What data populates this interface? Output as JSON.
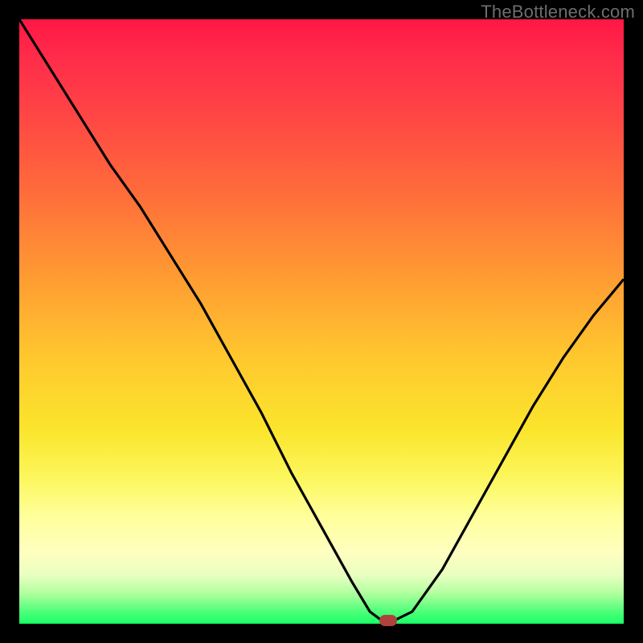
{
  "watermark": "TheBottleneck.com",
  "colors": {
    "curve_stroke": "#000000",
    "marker_fill": "#b0423e",
    "background": "#000000"
  },
  "chart_data": {
    "type": "line",
    "title": "",
    "xlabel": "",
    "ylabel": "",
    "xlim": [
      0,
      100
    ],
    "ylim": [
      0,
      100
    ],
    "grid": false,
    "legend": null,
    "series": [
      {
        "name": "bottleneck-curve",
        "x": [
          0,
          5,
          10,
          15,
          20,
          25,
          30,
          35,
          40,
          45,
          50,
          55,
          58,
          60,
          62,
          65,
          70,
          75,
          80,
          85,
          90,
          95,
          100
        ],
        "y": [
          100,
          92,
          84,
          76,
          69,
          61,
          53,
          44,
          35,
          25,
          16,
          7,
          2,
          0.5,
          0.5,
          2,
          9,
          18,
          27,
          36,
          44,
          51,
          57
        ]
      }
    ],
    "annotations": [
      {
        "type": "marker",
        "x": 61,
        "y": 0.5,
        "label": "optimal-point"
      }
    ]
  }
}
